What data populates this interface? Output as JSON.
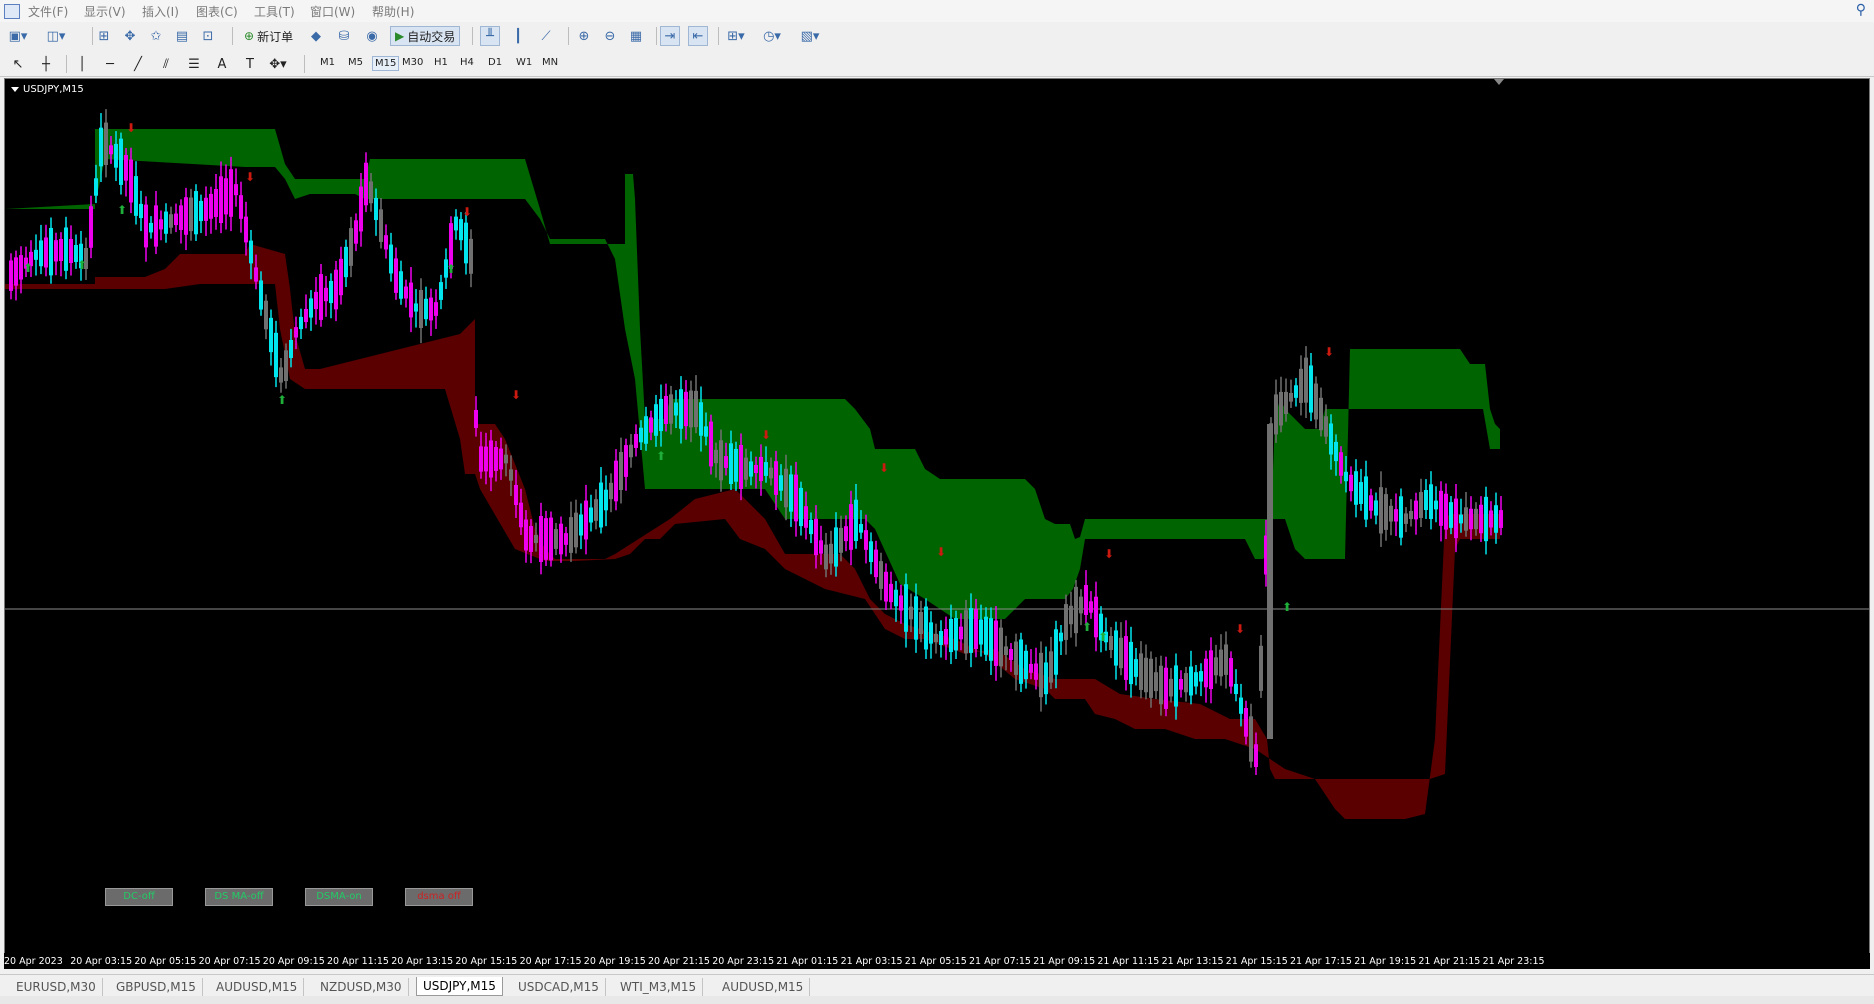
{
  "menu": {
    "items": [
      "文件(F)",
      "显示(V)",
      "插入(I)",
      "图表(C)",
      "工具(T)",
      "窗口(W)",
      "帮助(H)"
    ]
  },
  "toolbar": {
    "new_order": "新订单",
    "auto_trading": "自动交易"
  },
  "timeframes": [
    "M1",
    "M5",
    "M15",
    "M30",
    "H1",
    "H4",
    "D1",
    "W1",
    "MN"
  ],
  "active_timeframe": "M15",
  "chart": {
    "title": "USDJPY,M15",
    "buttons": [
      {
        "label": "DC-off",
        "color": "#22cc66"
      },
      {
        "label": "DS MA-off",
        "color": "#22cc66"
      },
      {
        "label": "DSMA-on",
        "color": "#22cc66"
      },
      {
        "label": "dsma off",
        "color": "#cc2222"
      }
    ],
    "time_labels": [
      "20 Apr 2023",
      "20 Apr 03:15",
      "20 Apr 05:15",
      "20 Apr 07:15",
      "20 Apr 09:15",
      "20 Apr 11:15",
      "20 Apr 13:15",
      "20 Apr 15:15",
      "20 Apr 17:15",
      "20 Apr 19:15",
      "20 Apr 21:15",
      "20 Apr 23:15",
      "21 Apr 01:15",
      "21 Apr 03:15",
      "21 Apr 05:15",
      "21 Apr 07:15",
      "21 Apr 09:15",
      "21 Apr 11:15",
      "21 Apr 13:15",
      "21 Apr 15:15",
      "21 Apr 17:15",
      "21 Apr 19:15",
      "21 Apr 21:15",
      "21 Apr 23:15"
    ],
    "colors": {
      "bull": "#00e5ee",
      "bear": "#ee00ee",
      "neutral": "#707070",
      "upper_band": "#006400",
      "lower_band": "#5a0000",
      "up_arrow": "#1fae3a",
      "down_arrow": "#cc1a10"
    }
  },
  "tabs": [
    "EURUSD,M30",
    "GBPUSD,M15",
    "AUDUSD,M15",
    "NZDUSD,M30",
    "USDJPY,M15",
    "USDCAD,M15",
    "WTI_M3,M15",
    "AUDUSD,M15"
  ],
  "active_tab": "USDJPY,M15"
}
